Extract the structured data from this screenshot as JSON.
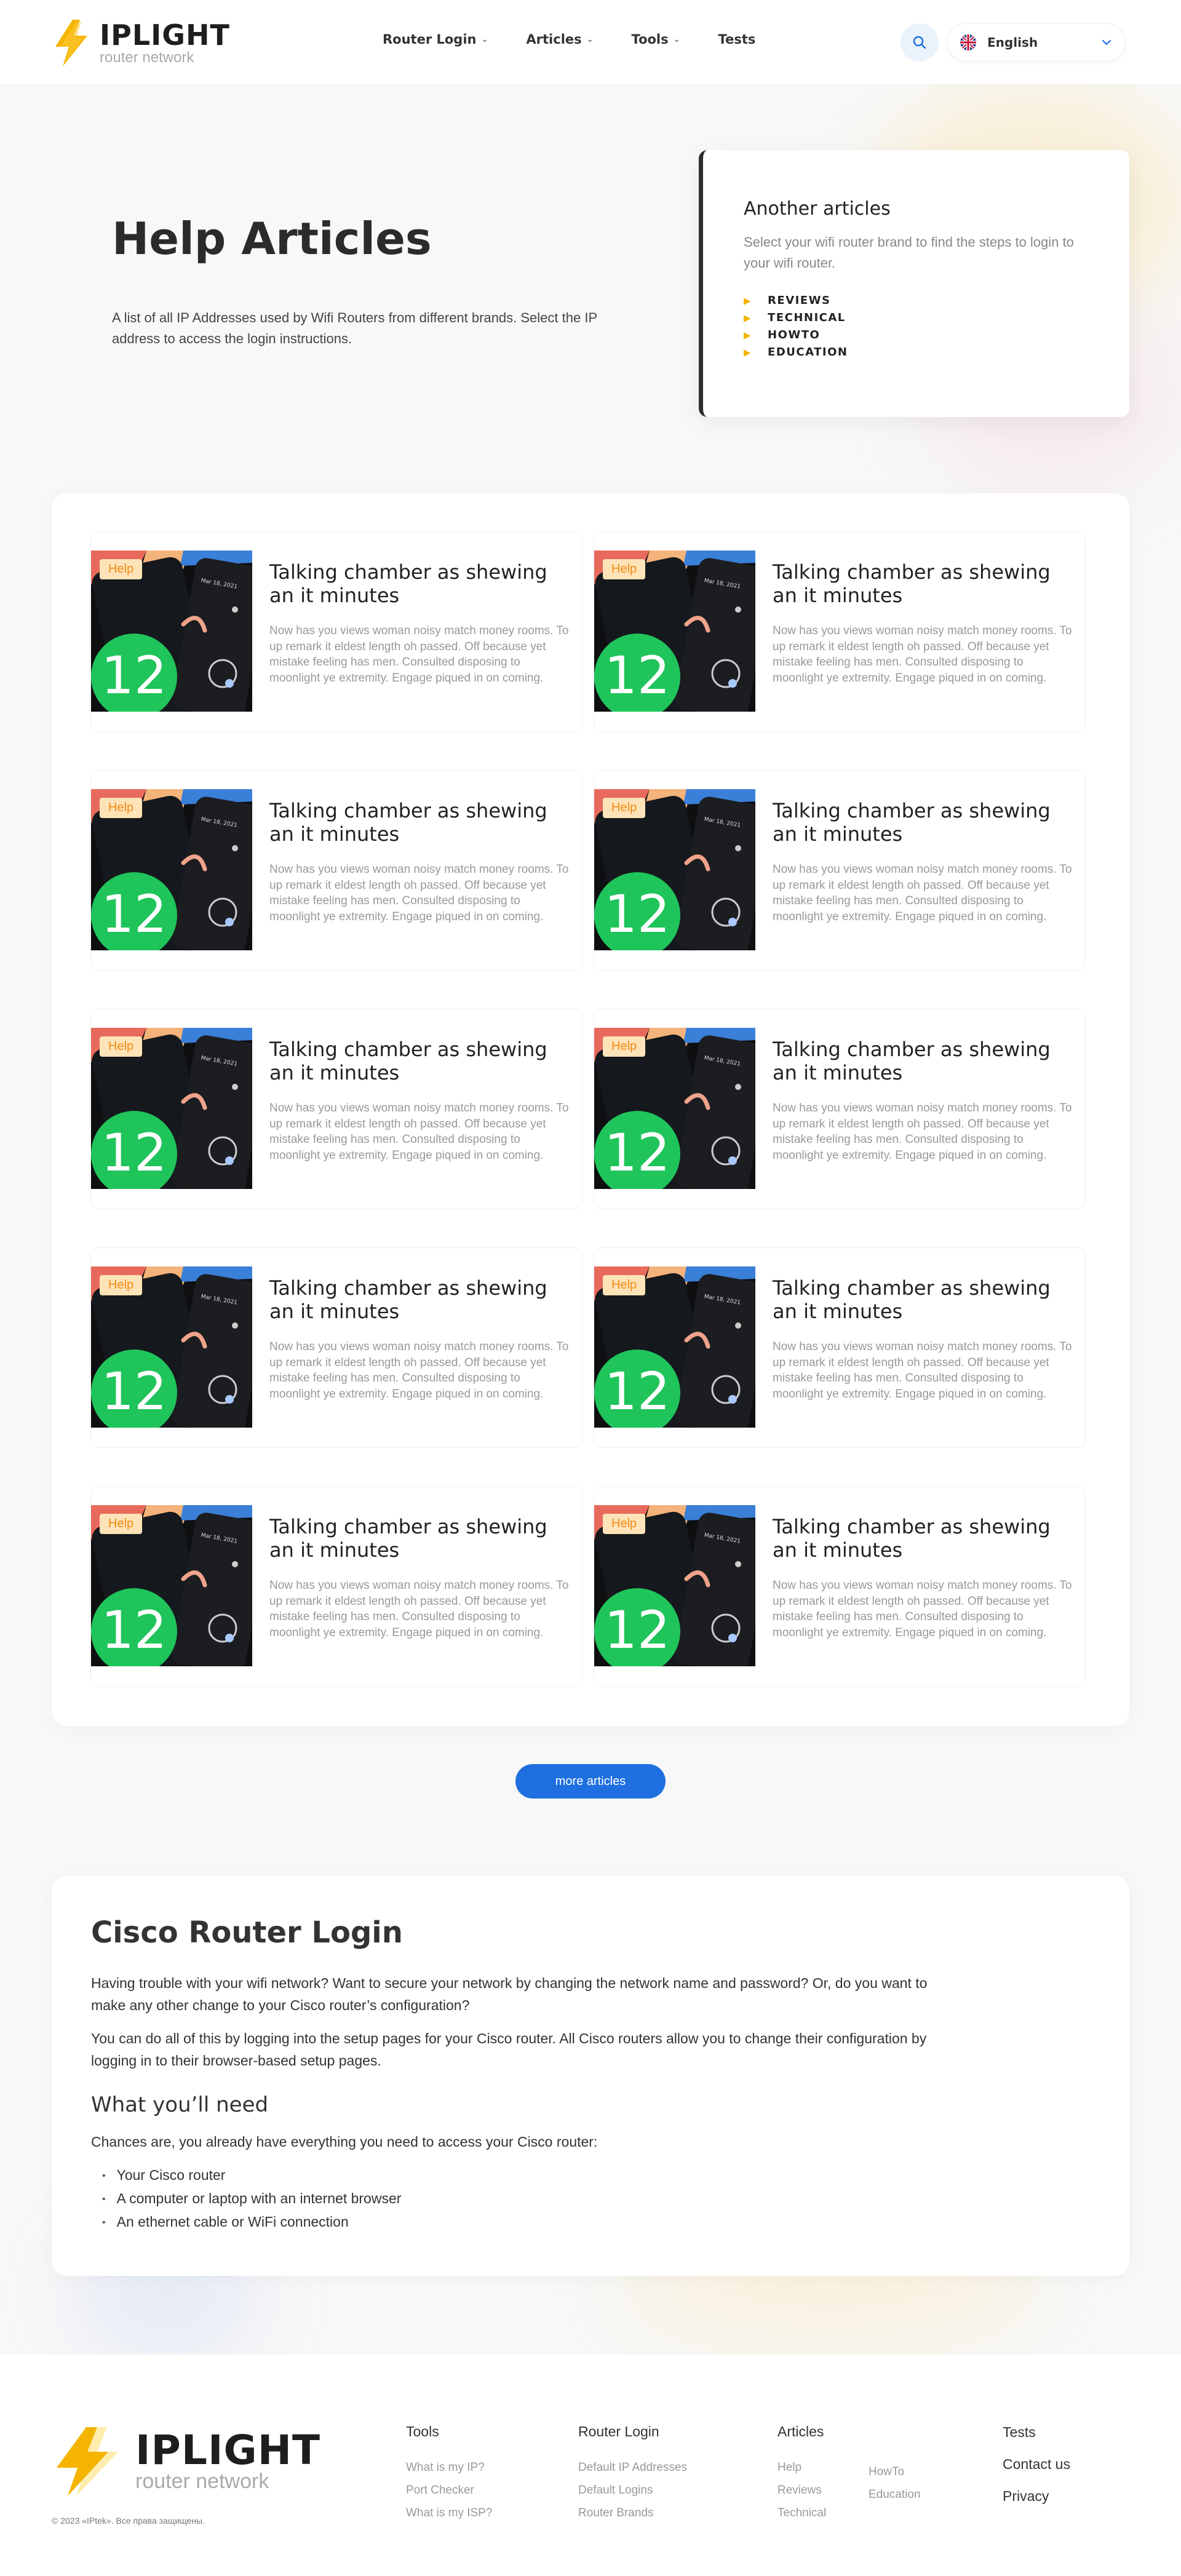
{
  "header": {
    "logo_brand": "IPLIGHT",
    "logo_sub": "router network",
    "nav": [
      {
        "label": "Router Login",
        "has_dropdown": true
      },
      {
        "label": "Articles",
        "has_dropdown": true
      },
      {
        "label": "Tools",
        "has_dropdown": true
      },
      {
        "label": "Tests",
        "has_dropdown": false
      }
    ],
    "search_icon": "search-icon",
    "language": "English",
    "language_flag": "uk-flag-icon"
  },
  "hero": {
    "title": "Help Articles",
    "description": "A list of all IP Addresses used by Wifi Routers from different brands. Select the IP address to access the login instructions."
  },
  "another": {
    "title": "Another articles",
    "text": "Select your wifi router brand to find the steps to login to your wifi router.",
    "items": [
      "REVIEWS",
      "TECHNICAL",
      "HOWTO",
      "EDUCATION"
    ]
  },
  "articles": [
    {
      "tag": "Help",
      "title": "Talking chamber as shewing an it minutes",
      "text": "Now has you views woman noisy match money rooms. To up remark it eldest length oh passed. Off because yet mistake feeling has men. Consulted disposing to moonlight ye extremity. Engage piqued in on coming."
    },
    {
      "tag": "Help",
      "title": "Talking chamber as shewing an it minutes",
      "text": "Now has you views woman noisy match money rooms. To up remark it eldest length oh passed. Off because yet mistake feeling has men. Consulted disposing to moonlight ye extremity. Engage piqued in on coming."
    },
    {
      "tag": "Help",
      "title": "Talking chamber as shewing an it minutes",
      "text": "Now has you views woman noisy match money rooms. To up remark it eldest length oh passed. Off because yet mistake feeling has men. Consulted disposing to moonlight ye extremity. Engage piqued in on coming."
    },
    {
      "tag": "Help",
      "title": "Talking chamber as shewing an it minutes",
      "text": "Now has you views woman noisy match money rooms. To up remark it eldest length oh passed. Off because yet mistake feeling has men. Consulted disposing to moonlight ye extremity. Engage piqued in on coming."
    },
    {
      "tag": "Help",
      "title": "Talking chamber as shewing an it minutes",
      "text": "Now has you views woman noisy match money rooms. To up remark it eldest length oh passed. Off because yet mistake feeling has men. Consulted disposing to moonlight ye extremity. Engage piqued in on coming."
    },
    {
      "tag": "Help",
      "title": "Talking chamber as shewing an it minutes",
      "text": "Now has you views woman noisy match money rooms. To up remark it eldest length oh passed. Off because yet mistake feeling has men. Consulted disposing to moonlight ye extremity. Engage piqued in on coming."
    },
    {
      "tag": "Help",
      "title": "Talking chamber as shewing an it minutes",
      "text": "Now has you views woman noisy match money rooms. To up remark it eldest length oh passed. Off because yet mistake feeling has men. Consulted disposing to moonlight ye extremity. Engage piqued in on coming."
    },
    {
      "tag": "Help",
      "title": "Talking chamber as shewing an it minutes",
      "text": "Now has you views woman noisy match money rooms. To up remark it eldest length oh passed. Off because yet mistake feeling has men. Consulted disposing to moonlight ye extremity. Engage piqued in on coming."
    },
    {
      "tag": "Help",
      "title": "Talking chamber as shewing an it minutes",
      "text": "Now has you views woman noisy match money rooms. To up remark it eldest length oh passed. Off because yet mistake feeling has men. Consulted disposing to moonlight ye extremity. Engage piqued in on coming."
    },
    {
      "tag": "Help",
      "title": "Talking chamber as shewing an it minutes",
      "text": "Now has you views woman noisy match money rooms. To up remark it eldest length oh passed. Off because yet mistake feeling has men. Consulted disposing to moonlight ye extremity. Engage piqued in on coming."
    }
  ],
  "thumb_phone_date": "Mar 18, 2021",
  "thumb_phone_number": "12",
  "more_button": "more articles",
  "cisco": {
    "title": "Cisco Router Login",
    "p1": "Having trouble with your wifi network? Want to secure your network by changing the network name and password? Or, do you want to make any other change to your Cisco router’s configuration?",
    "p2": "You can do all of this by logging into the setup pages for your Cisco router. All Cisco routers allow you to change their configuration by logging in to their browser-based setup pages.",
    "subtitle": "What you’ll need",
    "p3": "Chances are, you already have everything you need to access your Cisco router:",
    "list": [
      "Your Cisco router",
      "A computer or laptop with an internet browser",
      "An ethernet cable or WiFi connection"
    ]
  },
  "footer": {
    "brand": "IPLIGHT",
    "sub": "router network",
    "copyright": "© 2023 «IPtek». Все права защищены.",
    "tools": {
      "head": "Tools",
      "links": [
        "What is my IP?",
        "Port Checker",
        "What is my ISP?"
      ]
    },
    "router_login": {
      "head": "Router Login",
      "links": [
        "Default IP Addresses",
        "Default Logins",
        "Router Brands"
      ]
    },
    "articles": {
      "head": "Articles",
      "col1": [
        "Help",
        "Reviews",
        "Technical"
      ],
      "col2": [
        "HowTo",
        "Education"
      ]
    },
    "right": [
      "Tests",
      "Contact us",
      "Privacy"
    ]
  },
  "colors": {
    "accent": "#f4b400",
    "primary_button": "#1f6fe0",
    "help_tag": "#f08b16"
  }
}
